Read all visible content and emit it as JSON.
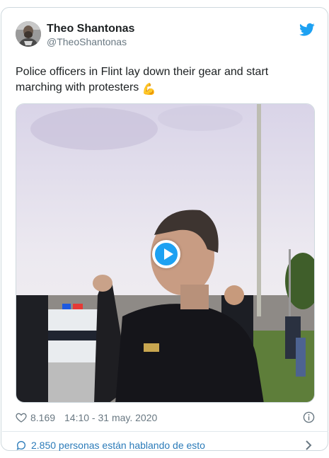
{
  "tweet": {
    "author_name": "Theo Shantonas",
    "author_handle": "@TheoShantonas",
    "text": "Police officers in Flint lay down their gear and start marching with protesters",
    "emoji": "💪",
    "media_kind": "video",
    "likes": "8.169",
    "timestamp": "14:10 - 31 may. 2020",
    "conversation_link": "2.850 personas están hablando de esto"
  },
  "colors": {
    "accent": "#1da1f2",
    "link": "#2b7bb9",
    "muted": "#697882",
    "border": "#cfd9de"
  },
  "icons": {
    "brand": "twitter-bird-icon",
    "like": "heart-icon",
    "info": "info-icon",
    "conversation": "speech-bubble-icon",
    "navigate": "chevron-right-icon",
    "play": "play-icon"
  }
}
